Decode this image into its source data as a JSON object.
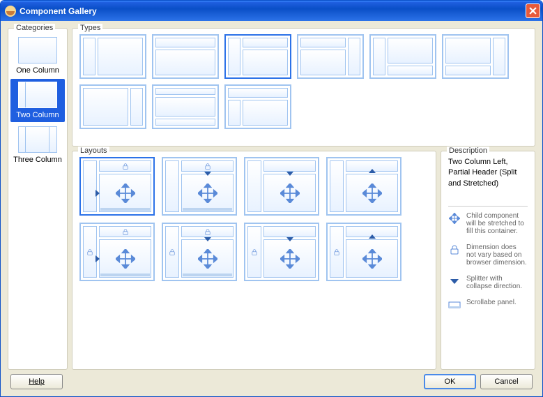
{
  "window": {
    "title": "Component Gallery"
  },
  "categories": {
    "label": "Categories",
    "items": [
      {
        "label": "One Column",
        "cols": 1
      },
      {
        "label": "Two Column",
        "cols": 2
      },
      {
        "label": "Three Column",
        "cols": 3
      }
    ],
    "selected": 1
  },
  "types": {
    "label": "Types",
    "items": [
      {
        "layout": "left-narrow"
      },
      {
        "layout": "top-small"
      },
      {
        "layout": "left-narrow-header",
        "selected": true
      },
      {
        "layout": "right-narrow-header"
      },
      {
        "layout": "left-narrow-footer"
      },
      {
        "layout": "right-narrow-footer"
      },
      {
        "layout": "right-narrow"
      },
      {
        "layout": "top-bottom-thin"
      },
      {
        "layout": "full-header-left"
      }
    ],
    "selected": 2
  },
  "layouts": {
    "label": "Layouts",
    "items": [
      {
        "variant": "A",
        "selected": true
      },
      {
        "variant": "B"
      },
      {
        "variant": "C"
      },
      {
        "variant": "D"
      },
      {
        "variant": "E"
      },
      {
        "variant": "F"
      },
      {
        "variant": "G"
      },
      {
        "variant": "H"
      }
    ],
    "selected": 0
  },
  "description": {
    "label": "Description",
    "text": "Two Column Left, Partial Header (Split and Stretched)",
    "legend": {
      "stretch": "Child component will be stretched to fill this container.",
      "lock": "Dimension does not vary based on browser dimension.",
      "splitter": "Splitter with collapse direction.",
      "scroll": "Scrollabe panel."
    }
  },
  "buttons": {
    "help": "Help",
    "ok": "OK",
    "cancel": "Cancel"
  }
}
